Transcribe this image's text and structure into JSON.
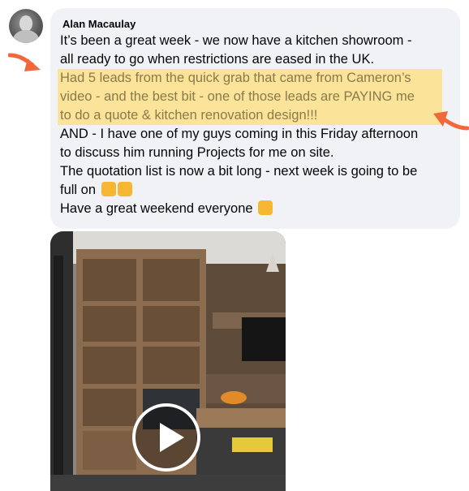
{
  "post": {
    "author": "Alan Macaulay",
    "lines": [
      "It’s been a great week - we now have a kitchen showroom -",
      "all ready to go when restrictions are eased in the UK.",
      "Had 5 leads from the quick grab that came from Cameron’s",
      "video - and the best bit - one of those leads are PAYING me",
      "to do a quote & kitchen renovation design!!!",
      "AND - I have one of my guys coming in this Friday afternoon",
      "to discuss him running Projects for me on site.",
      "The quotation list is now a bit long - next week is going to be",
      "full on",
      "Have a great weekend everyone"
    ],
    "emojis": [
      "thumbs-up-emoji",
      "flexed-biceps-emoji",
      "ok-hand-emoji"
    ]
  },
  "video": {
    "play_icon": "play-icon"
  },
  "colors": {
    "bubble": "#f0f2f5",
    "highlight": "#fbe49a",
    "highlight_text": "#8a7a4a",
    "arrow": "#f2683a"
  }
}
